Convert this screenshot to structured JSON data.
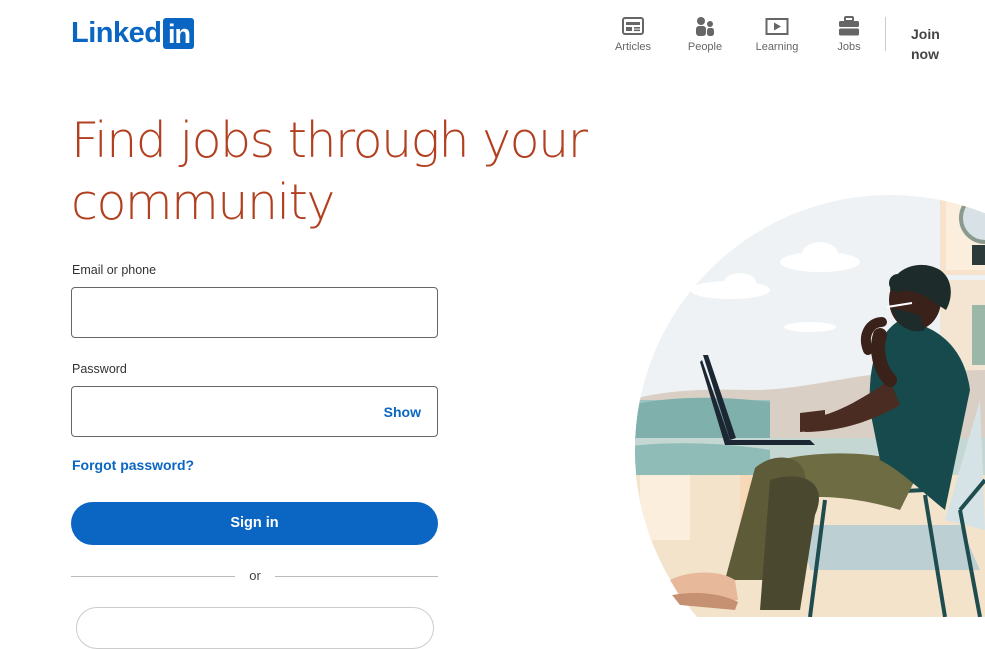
{
  "header": {
    "logo_text": "Linked",
    "logo_box": "in",
    "nav": [
      {
        "label": "Articles",
        "icon": "articles-icon"
      },
      {
        "label": "People",
        "icon": "people-icon"
      },
      {
        "label": "Learning",
        "icon": "learning-icon"
      },
      {
        "label": "Jobs",
        "icon": "jobs-icon"
      }
    ],
    "join_label": "Join now"
  },
  "hero": {
    "headline": "Find jobs through your community"
  },
  "form": {
    "email_label": "Email or phone",
    "email_value": "",
    "password_label": "Password",
    "password_value": "",
    "show_label": "Show",
    "forgot_label": "Forgot password?",
    "signin_label": "Sign in",
    "or_label": "or"
  },
  "colors": {
    "brand": "#0a66c2",
    "headline": "#b24020"
  }
}
